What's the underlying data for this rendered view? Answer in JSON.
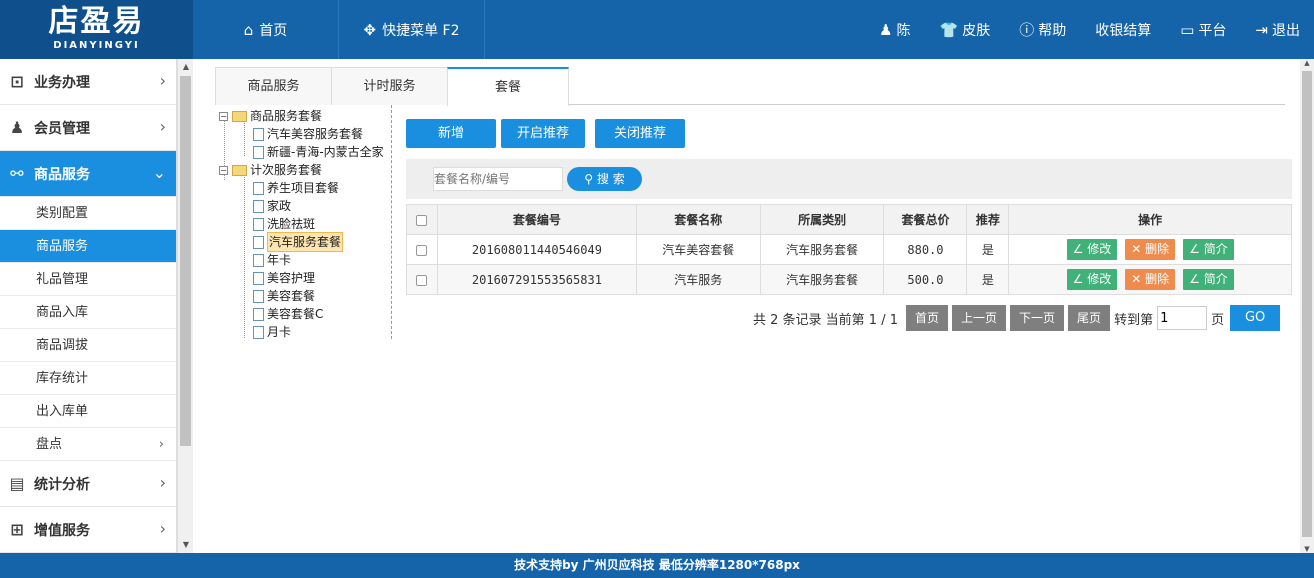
{
  "logo": {
    "cn": "店盈易",
    "en": "DIANYINGYI"
  },
  "topnav": {
    "home": {
      "label": "首页",
      "icon": "home-icon"
    },
    "menu": {
      "label": "快捷菜单 F2",
      "icon": "move-icon"
    },
    "user": {
      "label": "陈",
      "icon": "user-icon"
    },
    "skin": {
      "label": "皮肤",
      "icon": "shirt-icon"
    },
    "help": {
      "label": "帮助",
      "icon": "help-icon"
    },
    "cashier": {
      "label": "收银结算"
    },
    "platform": {
      "label": "平台",
      "icon": "monitor-icon"
    },
    "logout": {
      "label": "退出",
      "icon": "logout-icon"
    }
  },
  "sidebar": {
    "items": [
      {
        "label": "业务办理",
        "icon": "chart-icon"
      },
      {
        "label": "会员管理",
        "icon": "user-settings-icon"
      },
      {
        "label": "商品服务",
        "icon": "goods-icon",
        "active": true
      }
    ],
    "subitems": [
      {
        "label": "类别配置"
      },
      {
        "label": "商品服务",
        "active": true
      },
      {
        "label": "礼品管理"
      },
      {
        "label": "商品入库"
      },
      {
        "label": "商品调拔"
      },
      {
        "label": "库存统计"
      },
      {
        "label": "出入库单"
      },
      {
        "label": "盘点"
      }
    ],
    "bottom": [
      {
        "label": "统计分析",
        "icon": "stats-icon"
      },
      {
        "label": "增值服务",
        "icon": "book-icon"
      }
    ]
  },
  "tabs": [
    "商品服务",
    "计时服务",
    "套餐"
  ],
  "tree": {
    "group1": "商品服务套餐",
    "group1_items": [
      "汽车美容服务套餐",
      "新疆-青海-内蒙古全家"
    ],
    "group2": "计次服务套餐",
    "group2_items": [
      "养生项目套餐",
      "家政",
      "洗脸祛斑",
      "汽车服务套餐",
      "年卡",
      "美容护理",
      "美容套餐",
      "美容套餐C",
      "月卡"
    ]
  },
  "buttons": {
    "add": "新增",
    "enable": "开启推荐",
    "disable": "关闭推荐"
  },
  "search": {
    "placeholder": "套餐名称/编号",
    "button": "搜 索"
  },
  "table": {
    "headers": [
      "套餐编号",
      "套餐名称",
      "所属类别",
      "套餐总价",
      "推荐",
      "操作"
    ],
    "rows": [
      {
        "code": "201608011440546049",
        "name": "汽车美容套餐",
        "category": "汽车服务套餐",
        "price": "880.0",
        "recommend": "是"
      },
      {
        "code": "201607291553565831",
        "name": "汽车服务",
        "category": "汽车服务套餐",
        "price": "500.0",
        "recommend": "是"
      }
    ],
    "ops": {
      "edit": "修改",
      "delete": "删除",
      "intro": "简介"
    }
  },
  "pager": {
    "info": "共 2 条记录 当前第 1 / 1",
    "first": "首页",
    "prev": "上一页",
    "next": "下一页",
    "last": "尾页",
    "goto": "转到第",
    "page_value": "1",
    "page_unit": "页",
    "go": "GO"
  },
  "footer": "技术支持by 广州贝应科技    最低分辨率1280*768px"
}
